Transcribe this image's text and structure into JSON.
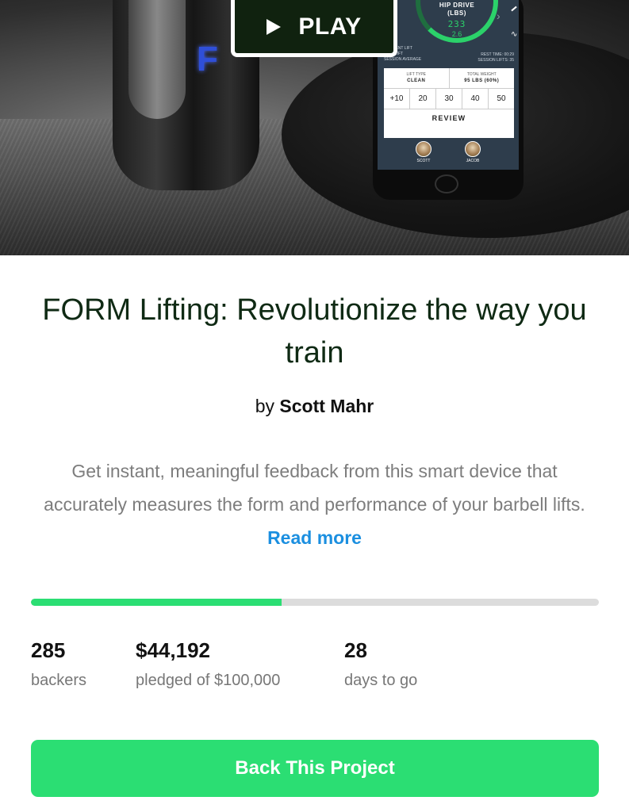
{
  "hero": {
    "play_label": "PLAY",
    "collar_logo": "F",
    "phone": {
      "hip_drive_title": "HIP DRIVE",
      "hip_drive_unit": "(LBS)",
      "hip_drive_value": "233",
      "hip_drive_sub": "2.6",
      "legend": [
        "CURRENT LIFT",
        "LAST LIFT",
        "SESSION AVERAGE"
      ],
      "rest_time": "REST TIME: 00:29",
      "session_lifts": "SESSION LIFTS: 35",
      "lift_type_label": "LIFT TYPE",
      "lift_type_value": "CLEAN",
      "total_weight_label": "TOTAL WEIGHT",
      "total_weight_value": "95 LBS (60%)",
      "weights": [
        "+10",
        "20",
        "30",
        "40",
        "50"
      ],
      "review_label": "REVIEW",
      "users": [
        "SCOTT",
        "JACOB"
      ]
    }
  },
  "project": {
    "title": "FORM Lifting: Revolutionize the way you train",
    "by_prefix": "by",
    "author": "Scott Mahr",
    "description": "Get instant, meaningful feedback from this smart device that accurately measures the form and performance of your barbell lifts.",
    "read_more": "Read more"
  },
  "funding": {
    "progress_fraction": 0.442,
    "backers_count": "285",
    "backers_label": "backers",
    "pledged_amount": "$44,192",
    "pledged_label": "pledged of $100,000",
    "days_count": "28",
    "days_label": "days to go"
  },
  "cta": {
    "back_label": "Back This Project"
  },
  "colors": {
    "accent_green": "#2bde73",
    "link_blue": "#1b8fe0",
    "title_dark_green": "#0f2a14"
  }
}
